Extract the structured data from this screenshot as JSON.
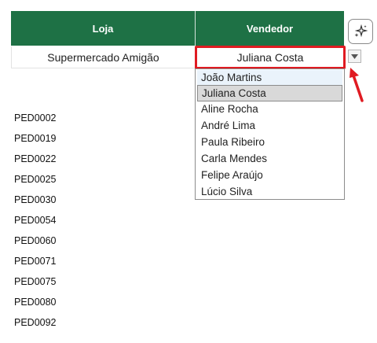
{
  "table": {
    "headers": [
      "Loja",
      "Vendedor"
    ],
    "loja_value": "Supermercado Amigão",
    "vendedor_value": "Juliana Costa"
  },
  "dropdown": {
    "options": [
      "João Martins",
      "Juliana Costa",
      "Aline Rocha",
      "André Lima",
      "Paula Ribeiro",
      "Carla Mendes",
      "Felipe Araújo",
      "Lúcio Silva"
    ],
    "highlighted": "Juliana Costa"
  },
  "orders": [
    "PED0002",
    "PED0019",
    "PED0022",
    "PED0025",
    "PED0030",
    "PED0054",
    "PED0060",
    "PED0071",
    "PED0075",
    "PED0080",
    "PED0092"
  ],
  "icons": {
    "ai_button": "sparkles-icon",
    "dropdown_button": "triangle-down-icon",
    "annotation": "red-arrow-icon"
  },
  "colors": {
    "header_bg": "#1e7145",
    "highlight_border": "#e01b22",
    "arrow": "#e01b22"
  }
}
